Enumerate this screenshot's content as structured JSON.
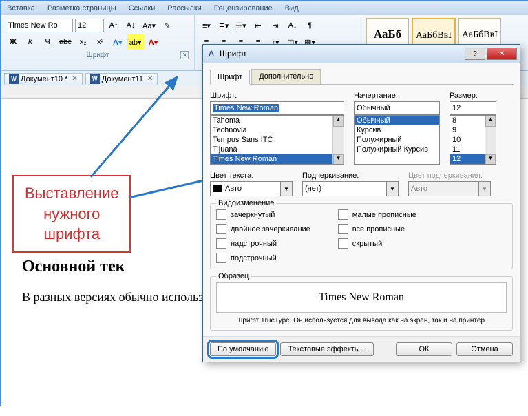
{
  "ribbon_tabs": [
    "Вставка",
    "Разметка страницы",
    "Ссылки",
    "Рассылки",
    "Рецензирование",
    "Вид"
  ],
  "font_group": {
    "font_name": "Times New Ro",
    "font_size": "12",
    "label": "Шрифт",
    "bold": "Ж",
    "italic": "К",
    "underline": "Ч",
    "strike": "abc",
    "sub": "x₂",
    "sup": "x²"
  },
  "styles": [
    {
      "sample": "АаБб",
      "name": "",
      "sel": false
    },
    {
      "sample": "АаБбВвI",
      "name": "",
      "sel": true
    },
    {
      "sample": "АаБбВвI",
      "name": "",
      "sel": false
    }
  ],
  "doc_tabs": [
    {
      "name": "Документ10 *"
    },
    {
      "name": "Документ11"
    }
  ],
  "callout": "Выставление\nнужного\nшрифта",
  "page": {
    "heading": "Основной тек",
    "para": "В разных версиях\nобычно использу"
  },
  "dialog": {
    "title": "Шрифт",
    "tab_font": "Шрифт",
    "tab_adv": "Дополнительно",
    "font_label": "Шрифт:",
    "font_value": "Times New Roman",
    "font_list": [
      "Tahoma",
      "Technovia",
      "Tempus Sans ITC",
      "Tijuana",
      "Times New Roman"
    ],
    "style_label": "Начертание:",
    "style_value": "Обычный",
    "style_list": [
      "Обычный",
      "Курсив",
      "Полужирный",
      "Полужирный Курсив"
    ],
    "size_label": "Размер:",
    "size_value": "12",
    "size_list": [
      "8",
      "9",
      "10",
      "11",
      "12"
    ],
    "color_label": "Цвет текста:",
    "color_value": "Авто",
    "underline_label": "Подчеркивание:",
    "underline_value": "(нет)",
    "ul_color_label": "Цвет подчеркивания:",
    "ul_color_value": "Авто",
    "effects_label": "Видоизменение",
    "effects_left": [
      "зачеркнутый",
      "двойное зачеркивание",
      "надстрочный",
      "подстрочный"
    ],
    "effects_right": [
      "малые прописные",
      "все прописные",
      "скрытый"
    ],
    "sample_label": "Образец",
    "sample_text": "Times New Roman",
    "hint": "Шрифт TrueType. Он используется для вывода как на экран, так и на принтер.",
    "btn_default": "По умолчанию",
    "btn_effects": "Текстовые эффекты...",
    "btn_ok": "ОК",
    "btn_cancel": "Отмена"
  }
}
